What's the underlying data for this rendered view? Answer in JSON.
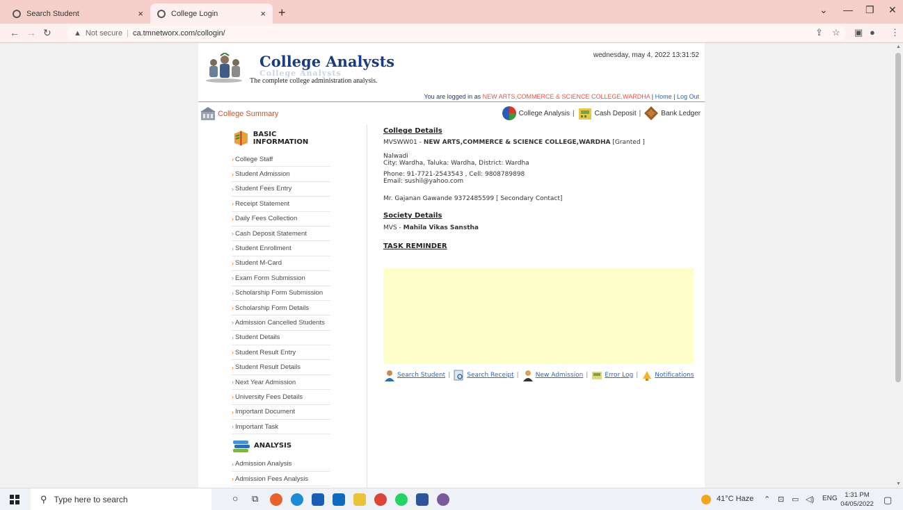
{
  "browser": {
    "tabs": [
      {
        "title": "Search Student",
        "close": "×"
      },
      {
        "title": "College Login",
        "close": "×"
      }
    ],
    "new_tab": "+",
    "url": "ca.tmnetworx.com/collogin/",
    "security_label": "Not secure",
    "controls": {
      "minimize": "—",
      "maximize": "❐",
      "close": "✕",
      "dropdown": "⌄"
    }
  },
  "header": {
    "brand": "College Analysts",
    "brand_reflection": "College Analysts",
    "tagline": "The complete college administration analysis.",
    "datetime": "wednesday, may 4, 2022 13:31:52",
    "logged_in_prefix": "You are logged in as",
    "logged_in_college": "NEW ARTS,COMMERCE & SCIENCE COLLEGE,WARDHA",
    "home": "Home",
    "logout": "Log Out"
  },
  "subheader": {
    "summary": "College Summary",
    "links": [
      "College Analysis",
      "Cash Deposit",
      "Bank Ledger"
    ]
  },
  "sidebar": {
    "basic_title": "BASIC INFORMATION",
    "items": [
      "College Staff",
      "Student Admission",
      "Student Fees Entry",
      "Receipt Statement",
      "Daily Fees Collection",
      "Cash Deposit Statement",
      "Student Enrollment",
      "Student M-Card",
      "Exam Form Submission",
      "Scholarship Form Submission",
      "Scholarship Form Details",
      "Admission Cancelled Students",
      "Student Details",
      "Student Result Entry",
      "Student Result Details",
      "Next Year Admission",
      "University Fees Details",
      "Important Document",
      "Important Task"
    ],
    "analysis_title": "ANALYSIS",
    "analysis_items": [
      "Admission Analysis",
      "Admission Fees Analysis"
    ]
  },
  "college": {
    "heading": "College Details",
    "code": "MVSWW01",
    "name": "NEW ARTS,COMMERCE & SCIENCE COLLEGE,WARDHA",
    "status": "[Granted ]",
    "area": "Nalwadi",
    "city_line": "City: Wardha, Taluka: Wardha, District: Wardha",
    "phone_line": "Phone: 91-7721-2543543 , Cell: 9808789898",
    "email_line": "Email: sushil@yahoo.com",
    "contact_line": "Mr. Gajanan Gawande 9372485599 [ Secondary Contact]"
  },
  "society": {
    "heading": "Society Details",
    "code": "MVS",
    "name": "Mahila Vikas Sanstha"
  },
  "task_reminder": "TASK REMINDER",
  "bottom_links": [
    "Search Student",
    "Search Receipt",
    "New Admission",
    "Error Log",
    "Notifications"
  ],
  "taskbar": {
    "search_placeholder": "Type here to search",
    "weather": "41°C  Haze",
    "lang": "ENG",
    "time": "1:31 PM",
    "date": "04/05/2022"
  }
}
